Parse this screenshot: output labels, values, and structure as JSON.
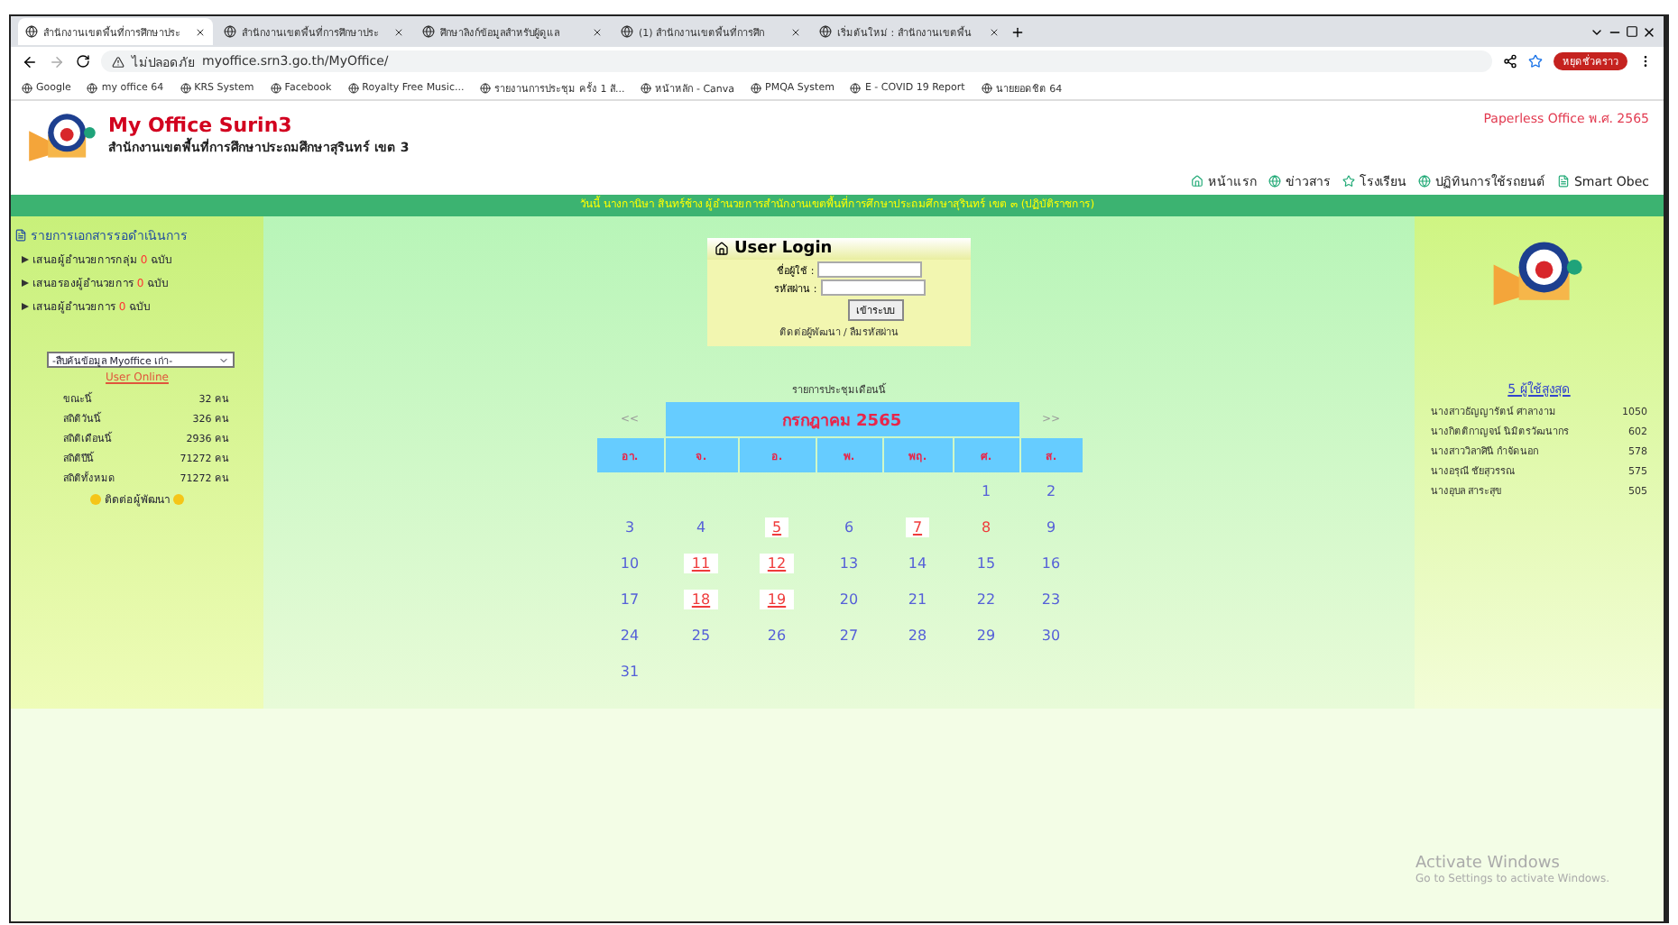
{
  "browser": {
    "tabs": [
      {
        "title": "สำนักงานเขตพื้นที่การศึกษาประ",
        "selected": true
      },
      {
        "title": "สำนักงานเขตพื้นที่การศึกษาประ",
        "selected": false
      },
      {
        "title": "ศึกษาลิงก์ข้อมูลสำหรับผู้ดูแล",
        "selected": false
      },
      {
        "title": "(1) สำนักงานเขตพื้นที่การศึก",
        "selected": false
      },
      {
        "title": "เริ่มต้นใหม่ : สำนักงานเขตพื้น",
        "selected": false
      }
    ],
    "security": "ไม่ปลอดภัย",
    "url": "myoffice.srn3.go.th/MyOffice/",
    "profile": "หยุดชั่วคราว",
    "bookmarks": [
      "Google",
      "my office 64",
      "KRS System",
      "Facebook",
      "Royalty Free Music...",
      "รายงานการประชุม ครั้ง 1 สั...",
      "หน้าหลัก - Canva",
      "PMQA System",
      "E - COVID 19 Report",
      "นายยอดชิต 64"
    ]
  },
  "header": {
    "title": "My Office Surin3",
    "subtitle": "สำนักงานเขตพื้นที่การศึกษาประถมศึกษาสุรินทร์ เขต 3",
    "badge": "Paperless Office พ.ศ. 2565",
    "nav": [
      "หน้าแรก",
      "ข่าวสาร",
      "โรงเรียน",
      "ปฏิทินการใช้รถยนต์",
      "Smart Obec"
    ]
  },
  "announcement": "วันนี้ นางกานิษา สินทร์ช้าง ผู้อำนวยการสำนักงานเขตพื้นที่การศึกษาประถมศึกษาสุรินทร์ เขต ๓ (ปฏิบัติราชการ)",
  "sidebar": {
    "heading": "รายการเอกสารรอดำเนินการ",
    "pending": [
      {
        "label": "เสนอผู้อำนวยการกลุ่ม",
        "count": "0",
        "unit": "ฉบับ"
      },
      {
        "label": "เสนอรองผู้อำนวยการ",
        "count": "0",
        "unit": "ฉบับ"
      },
      {
        "label": "เสนอผู้อำนวยการ",
        "count": "0",
        "unit": "ฉบับ"
      }
    ],
    "search_select": "-สืบค้นข้อมูล Myoffice เก่า-",
    "online_link": "User Online",
    "stats": [
      {
        "label": "ขณะนี้",
        "value": "32 คน"
      },
      {
        "label": "สถิติวันนี้",
        "value": "326 คน"
      },
      {
        "label": "สถิติเดือนนี้",
        "value": "2936 คน"
      },
      {
        "label": "สถิติปีนี้",
        "value": "71272 คน"
      },
      {
        "label": "สถิติทั้งหมด",
        "value": "71272 คน"
      }
    ],
    "contact": "ติดต่อผู้พัฒนา"
  },
  "login": {
    "title": "User Login",
    "username_label": "ชื่อผู้ใช้ :",
    "password_label": "รหัสผ่าน :",
    "submit": "เข้าระบบ",
    "footer": "ติดต่อผู้พัฒนา / ลืมรหัสผ่าน"
  },
  "calendar": {
    "caption": "รายการประชุมเดือนนี้",
    "prev": "<<",
    "month": "กรกฎาคม 2565",
    "next": ">>",
    "weekdays": [
      "อา.",
      "จ.",
      "อ.",
      "พ.",
      "พฤ.",
      "ศ.",
      "ส."
    ],
    "weeks": [
      [
        {
          "day": "1",
          "kind": "normal"
        },
        {
          "day": "2",
          "kind": "normal"
        }
      ],
      [
        {
          "day": "3",
          "kind": "normal"
        },
        {
          "day": "4",
          "kind": "normal"
        },
        {
          "day": "5",
          "kind": "event"
        },
        {
          "day": "6",
          "kind": "normal"
        },
        {
          "day": "7",
          "kind": "event"
        },
        {
          "day": "8",
          "kind": "holiday"
        },
        {
          "day": "9",
          "kind": "normal"
        }
      ],
      [
        {
          "day": "10",
          "kind": "normal"
        },
        {
          "day": "11",
          "kind": "event"
        },
        {
          "day": "12",
          "kind": "event"
        },
        {
          "day": "13",
          "kind": "normal"
        },
        {
          "day": "14",
          "kind": "normal"
        },
        {
          "day": "15",
          "kind": "normal"
        },
        {
          "day": "16",
          "kind": "normal"
        }
      ],
      [
        {
          "day": "17",
          "kind": "normal"
        },
        {
          "day": "18",
          "kind": "event"
        },
        {
          "day": "19",
          "kind": "event"
        },
        {
          "day": "20",
          "kind": "normal"
        },
        {
          "day": "21",
          "kind": "normal"
        },
        {
          "day": "22",
          "kind": "normal"
        },
        {
          "day": "23",
          "kind": "normal"
        }
      ],
      [
        {
          "day": "24",
          "kind": "normal"
        },
        {
          "day": "25",
          "kind": "normal"
        },
        {
          "day": "26",
          "kind": "normal"
        },
        {
          "day": "27",
          "kind": "normal"
        },
        {
          "day": "28",
          "kind": "normal"
        },
        {
          "day": "29",
          "kind": "normal"
        },
        {
          "day": "30",
          "kind": "normal"
        }
      ],
      [
        {
          "day": "31",
          "kind": "normal"
        }
      ]
    ]
  },
  "top_users": {
    "heading": "5 ผู้ใช้สูงสุด",
    "users": [
      {
        "name": "นางสาวธัญญารัตน์ ศาลางาม",
        "count": "1050"
      },
      {
        "name": "นางกิตติกาญจน์ นิมิตรวัฒนากร",
        "count": "602"
      },
      {
        "name": "นางสาววิลาศินี กำจัดนอก",
        "count": "578"
      },
      {
        "name": "นางอรุณี ชัยสุวรรณ",
        "count": "575"
      },
      {
        "name": "นางอุบล สาระสุข",
        "count": "505"
      }
    ]
  },
  "activation": {
    "title": "Activate Windows",
    "hint": "Go to Settings to activate Windows."
  }
}
